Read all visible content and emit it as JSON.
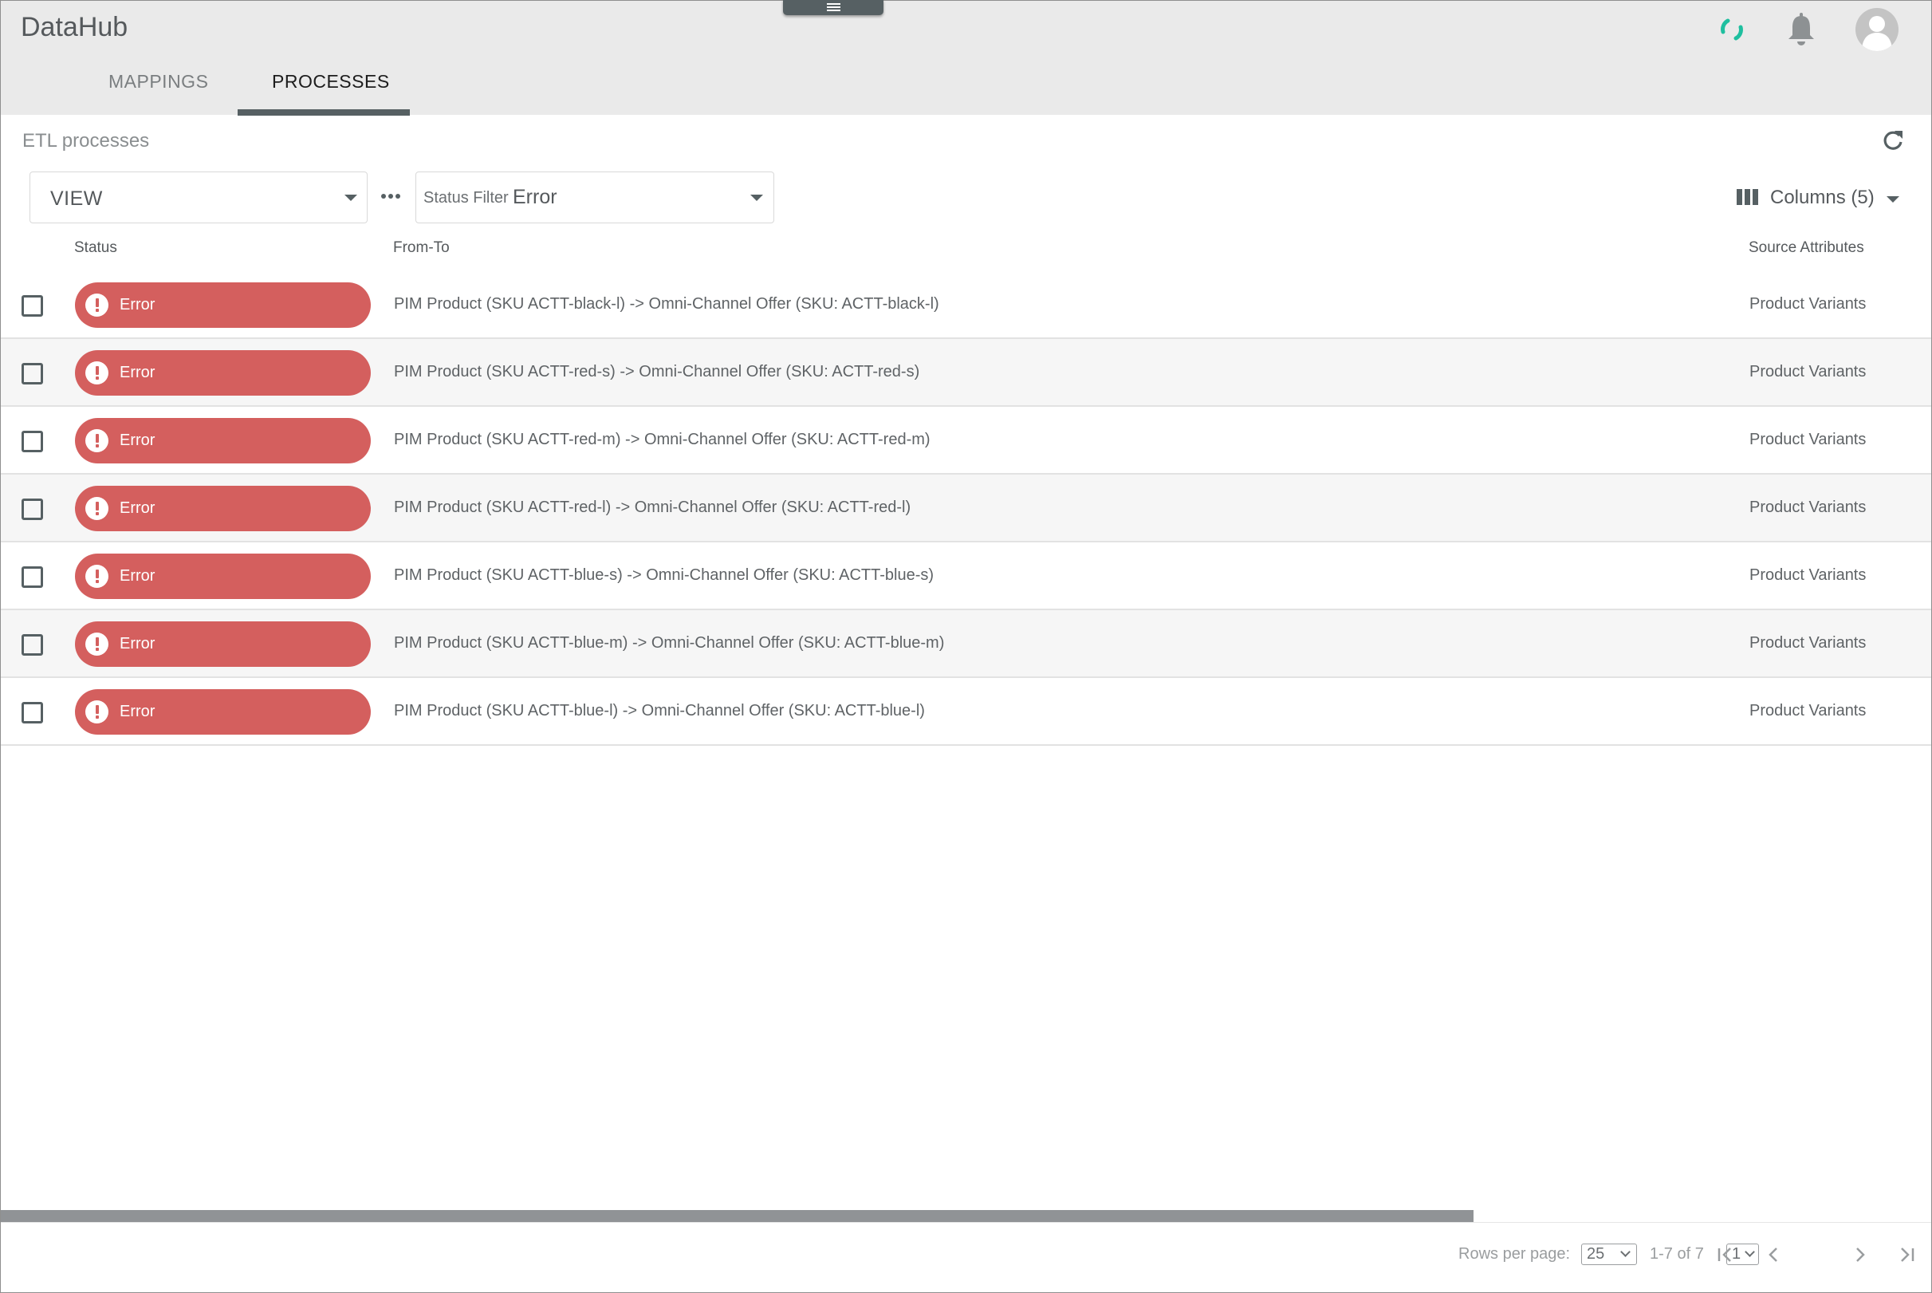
{
  "app": {
    "title": "DataHub"
  },
  "tabs": [
    {
      "label": "MAPPINGS",
      "active": false
    },
    {
      "label": "PROCESSES",
      "active": true
    }
  ],
  "header_icons": {
    "status": "loading-spinner-icon",
    "notifications": "bell-icon",
    "user": "avatar-icon",
    "spinner_color": "#1fbf9f"
  },
  "section": {
    "title": "ETL processes",
    "refresh_icon": "refresh-icon"
  },
  "toolbar": {
    "view_select": {
      "value": "VIEW"
    },
    "more_icon": "more-horizontal-icon",
    "status_filter": {
      "label": "Status Filter",
      "value": "Error"
    },
    "columns_button": {
      "label": "Columns (5)",
      "icon": "columns-icon"
    }
  },
  "table": {
    "columns": [
      "Status",
      "From-To",
      "Source Attributes"
    ],
    "status_color": "#d45f5e",
    "rows": [
      {
        "status": "Error",
        "from_to": "PIM Product (SKU ACTT-black-l) -> Omni-Channel Offer (SKU: ACTT-black-l)",
        "source_attributes": "Product Variants"
      },
      {
        "status": "Error",
        "from_to": "PIM Product (SKU ACTT-red-s) -> Omni-Channel Offer (SKU: ACTT-red-s)",
        "source_attributes": "Product Variants"
      },
      {
        "status": "Error",
        "from_to": "PIM Product (SKU ACTT-red-m) -> Omni-Channel Offer (SKU: ACTT-red-m)",
        "source_attributes": "Product Variants"
      },
      {
        "status": "Error",
        "from_to": "PIM Product (SKU ACTT-red-l) -> Omni-Channel Offer (SKU: ACTT-red-l)",
        "source_attributes": "Product Variants"
      },
      {
        "status": "Error",
        "from_to": "PIM Product (SKU ACTT-blue-s) -> Omni-Channel Offer (SKU: ACTT-blue-s)",
        "source_attributes": "Product Variants"
      },
      {
        "status": "Error",
        "from_to": "PIM Product (SKU ACTT-blue-m) -> Omni-Channel Offer (SKU: ACTT-blue-m)",
        "source_attributes": "Product Variants"
      },
      {
        "status": "Error",
        "from_to": "PIM Product (SKU ACTT-blue-l) -> Omni-Channel Offer (SKU: ACTT-blue-l)",
        "source_attributes": "Product Variants"
      }
    ]
  },
  "pagination": {
    "rows_per_page_label": "Rows per page:",
    "rows_per_page": "25",
    "range": "1-7 of 7",
    "page": "1"
  }
}
